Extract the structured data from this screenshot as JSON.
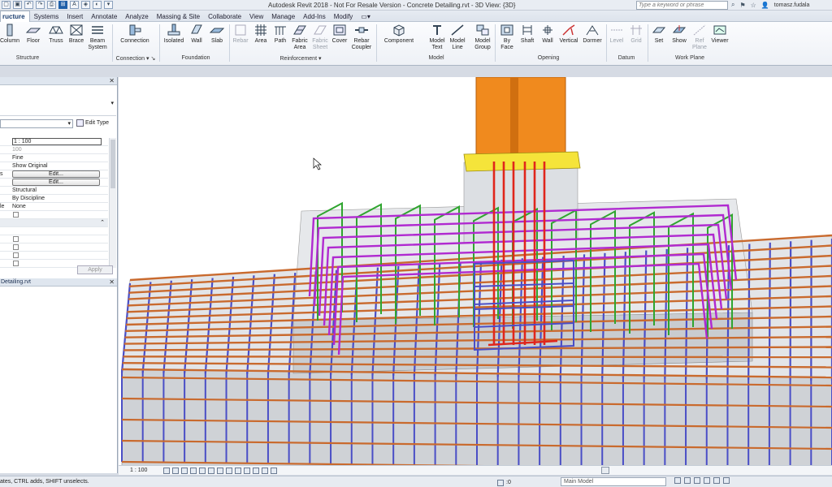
{
  "window": {
    "title": "Autodesk Revit 2018 -  Not For Resale Version -    Concrete Detailing.rvt - 3D View: {3D}",
    "search_placeholder": "Type a keyword or phrase",
    "user": "tomasz.fudala"
  },
  "menu": {
    "tabs": [
      "ructure",
      "Systems",
      "Insert",
      "Annotate",
      "Analyze",
      "Massing & Site",
      "Collaborate",
      "View",
      "Manage",
      "Add-Ins",
      "Modify"
    ]
  },
  "ribbon": {
    "structure": {
      "group": "Structure",
      "buttons": [
        "Column",
        "Floor",
        "Truss",
        "Brace",
        "Beam System"
      ]
    },
    "connection": {
      "group": "Connection",
      "buttons": [
        "Connection"
      ]
    },
    "foundation": {
      "group": "Foundation",
      "buttons": [
        "Isolated",
        "Wall",
        "Slab"
      ]
    },
    "reinforcement": {
      "group": "Reinforcement",
      "buttons": [
        "Rebar",
        "Area",
        "Path",
        "Fabric Area",
        "Fabric Sheet",
        "Cover",
        "Rebar Coupler"
      ]
    },
    "model": {
      "group": "Model",
      "buttons": [
        "Component",
        "Model Text",
        "Model Line",
        "Model Group"
      ]
    },
    "opening": {
      "group": "Opening",
      "buttons": [
        "By Face",
        "Shaft",
        "Wall",
        "Vertical",
        "Dormer"
      ]
    },
    "datum": {
      "group": "Datum",
      "buttons": [
        "Level",
        "Grid"
      ]
    },
    "workplane": {
      "group": "Work Plane",
      "buttons": [
        "Set",
        "Show",
        "Ref Plane",
        "Viewer"
      ]
    }
  },
  "properties": {
    "edit_type": "Edit Type",
    "rows": [
      {
        "key": "",
        "value": "1 : 100",
        "style": "box"
      },
      {
        "key": "",
        "value": "100",
        "style": "gray"
      },
      {
        "key": "",
        "value": "Fine",
        "style": ""
      },
      {
        "key": "",
        "value": "Show Original",
        "style": ""
      },
      {
        "key": "s",
        "value": "Edit...",
        "style": "button"
      },
      {
        "key": "",
        "value": "Edit...",
        "style": "button"
      },
      {
        "key": "",
        "value": "Structural",
        "style": ""
      },
      {
        "key": "",
        "value": "By Discipline",
        "style": ""
      },
      {
        "key": "le",
        "value": "None",
        "style": ""
      },
      {
        "key": "",
        "value": "",
        "style": "checkbox"
      },
      {
        "key": "",
        "value": "",
        "style": "group"
      },
      {
        "key": "",
        "value": "",
        "style": "empty"
      },
      {
        "key": "",
        "value": "",
        "style": "checkbox"
      },
      {
        "key": "",
        "value": "",
        "style": "checkbox"
      },
      {
        "key": "",
        "value": "",
        "style": "checkbox"
      },
      {
        "key": "",
        "value": "",
        "style": "checkbox"
      }
    ],
    "apply": "Apply"
  },
  "browser": {
    "title": "Detailing.rvt"
  },
  "view": {
    "scale": "1 : 100"
  },
  "status": {
    "hint": "ates, CTRL adds, SHIFT unselects.",
    "zero": ":0",
    "model": "Main Model"
  },
  "colors": {
    "column": "#f08a1e",
    "plate": "#f5e43a",
    "rebar_orange": "#c96a2e",
    "rebar_blue": "#4a4ec6",
    "rebar_green": "#2fa52f",
    "rebar_magenta": "#b02ad0",
    "rebar_red": "#e0261c"
  }
}
